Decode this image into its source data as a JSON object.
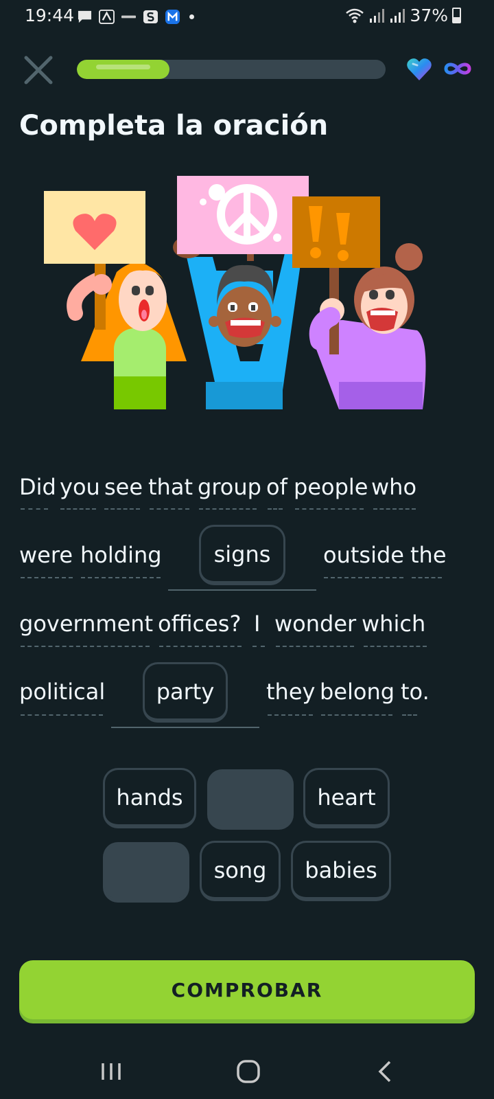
{
  "status_bar": {
    "time": "19:44",
    "battery": "37%",
    "icons": [
      "message-icon",
      "app-a-icon",
      "app-small-icon",
      "s-app-icon",
      "m-app-icon",
      "notification-dot-icon",
      "wifi-icon",
      "signal-icon",
      "signal-icon-2",
      "battery-icon"
    ]
  },
  "top_bar": {
    "close_icon": "close-icon",
    "progress": 0.3,
    "hearts_icon": "heart-gem-icon",
    "hearts_value_icon": "infinity-icon"
  },
  "title": "Completa la oración",
  "sentence": {
    "words": [
      "Did",
      "you",
      "see",
      "that",
      "group",
      "of",
      "people",
      "who",
      "were",
      "holding",
      "outside",
      "the",
      "government",
      "offices?",
      "I",
      "wonder",
      "which",
      "political",
      "they",
      "belong",
      "to."
    ],
    "blanks": [
      "signs",
      "party"
    ]
  },
  "word_bank": {
    "options": [
      "hands",
      "",
      "heart",
      "",
      "song",
      "babies"
    ]
  },
  "check_button": "COMPROBAR",
  "nav_bar": {
    "icons": [
      "recent-apps-icon",
      "home-icon",
      "back-icon"
    ]
  },
  "colors": {
    "background": "#131f24",
    "accent_green": "#93d333",
    "chip_border": "#37464f",
    "text": "#f1f7fb"
  }
}
